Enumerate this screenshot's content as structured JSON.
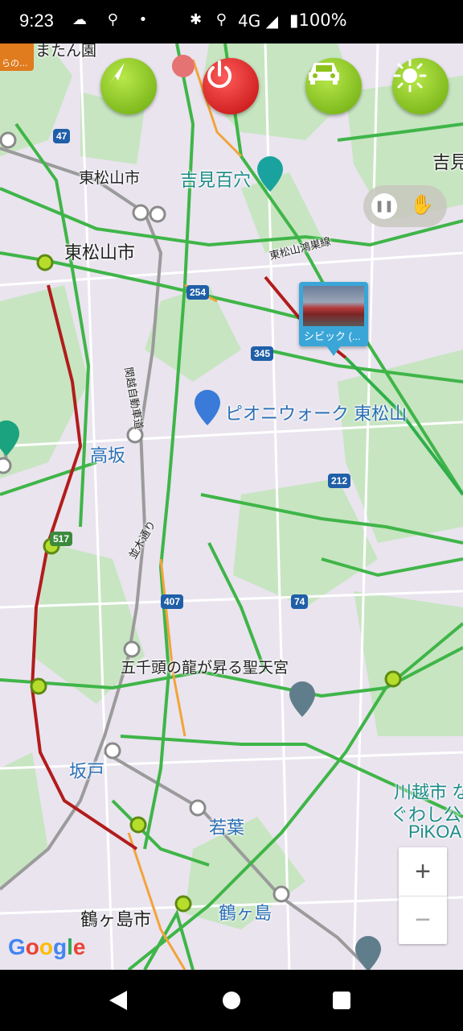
{
  "status_bar": {
    "time": "9:23",
    "left_icons": "☁ ⚲ •",
    "right_icons": "✱ ⚲",
    "network": "4G ◢",
    "battery": "▮100%"
  },
  "map": {
    "place_labels": [
      {
        "text": "東松山市",
        "style": "big"
      },
      {
        "text": "東松山市",
        "style": "med"
      },
      {
        "text": "吉見百穴",
        "style": "teal"
      },
      {
        "text": "高坂",
        "style": "blue"
      },
      {
        "text": "ピオニウォーク 東松山",
        "style": "blue"
      },
      {
        "text": "五千頭の龍が昇る聖天宮",
        "style": "med"
      },
      {
        "text": "坂戸",
        "style": "blue"
      },
      {
        "text": "若葉",
        "style": "blue"
      },
      {
        "text": "鶴ヶ島",
        "style": "blue"
      },
      {
        "text": "鶴ヶ島市",
        "style": "big"
      },
      {
        "text": "吉見",
        "style": "big"
      },
      {
        "text": "川越市 な",
        "style": "teal"
      },
      {
        "text": "ぐわし公",
        "style": "teal"
      },
      {
        "text": "PiKOA",
        "style": "teal"
      },
      {
        "text": "またん園",
        "style": "med"
      }
    ],
    "road_labels": [
      "東松山鴻巣線",
      "関越自動車道",
      "並木通り"
    ],
    "route_shields": [
      "47",
      "254",
      "345",
      "212",
      "517",
      "407",
      "74"
    ],
    "station_suffix": "〒",
    "attribution": "Google"
  },
  "controls": {
    "navigate_icon": "arrow-icon",
    "power_icon": "power-icon",
    "car_icon": "car-icon",
    "sun_icon": "sun-icon",
    "pause_icon": "pause-icon",
    "hand_icon": "hand-icon",
    "zoom_in": "+",
    "zoom_out": "−"
  },
  "car_marker": {
    "caption": "シビック (..."
  },
  "corner_thumb_caption": "らの..."
}
